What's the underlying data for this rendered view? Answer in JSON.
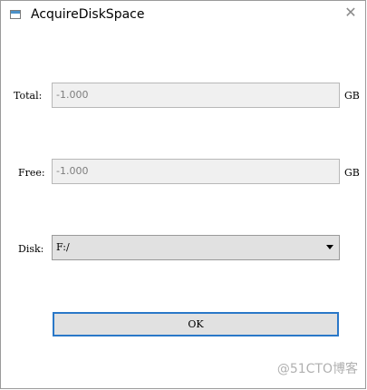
{
  "window": {
    "title": "AcquireDiskSpace",
    "close_glyph": "✕"
  },
  "form": {
    "total": {
      "label": "Total:",
      "value": "-1.000",
      "unit": "GB"
    },
    "free": {
      "label": "Free:",
      "value": "-1.000",
      "unit": "GB"
    },
    "disk": {
      "label": "Disk:",
      "selected": "F:/"
    },
    "ok_label": "OK"
  },
  "watermark": "@51CTO博客",
  "icons": {
    "app": "window-icon",
    "close": "close-icon",
    "dropdown": "chevron-down-icon"
  },
  "colors": {
    "focus_border": "#2a78c8",
    "field_bg": "#f0f0f0",
    "button_bg": "#e1e1e1"
  }
}
